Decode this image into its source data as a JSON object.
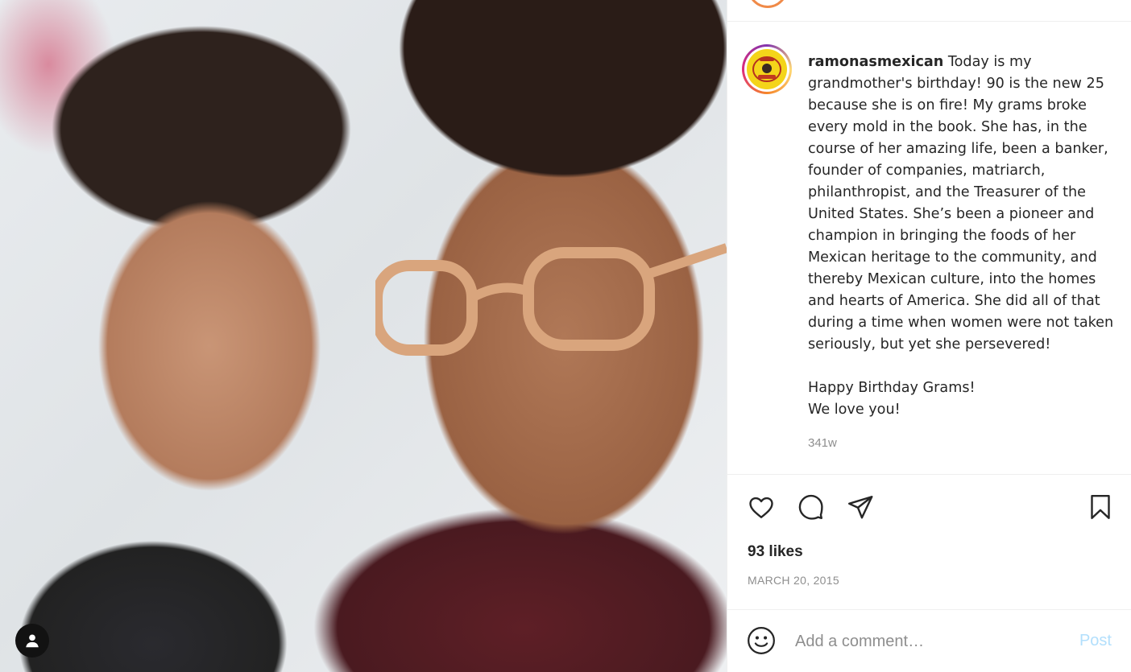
{
  "post": {
    "username": "ramonasmexican",
    "caption_lines": [
      "Today is my grandmother's birthday! 90 is the new 25 because she is on fire! My grams broke every mold in the book. She has, in the course of her amazing life, been a banker, founder of companies, matriarch, philanthropist, and the Treasurer of the United States. She’s been a pioneer and champion in bringing the foods of her Mexican heritage to the community, and thereby Mexican culture, into the homes and hearts of America. She did all of that during a time when women were not taken seriously, but yet she persevered!",
      "",
      "Happy Birthday Grams!",
      "We love you!"
    ],
    "caption_text": "Today is my grandmother's birthday! 90 is the new 25 because she is on fire! My grams broke every mold in the book. She has, in the course of her amazing life, been a banker, founder of companies, matriarch, philanthropist, and the Treasurer of the United States. She’s been a pioneer and champion in bringing the foods of her Mexican heritage to the community, and thereby Mexican culture, into the homes and hearts of America. She did all of that during a time when women were not taken seriously, but yet she persevered!\n\nHappy Birthday Grams!\nWe love you!",
    "time_ago": "341w",
    "likes": "93 likes",
    "date": "MARCH 20, 2015"
  },
  "comment": {
    "placeholder": "Add a comment…",
    "post_label": "Post"
  },
  "icons": {
    "like": "heart-icon",
    "comment": "comment-bubble-icon",
    "share": "paper-plane-icon",
    "save": "bookmark-icon",
    "emoji": "smiley-icon",
    "user_badge": "user-icon"
  },
  "colors": {
    "text": "#262626",
    "muted": "#8e8e8e",
    "post_disabled": "#b2dffc",
    "profile_bg": "#f4d41a"
  }
}
